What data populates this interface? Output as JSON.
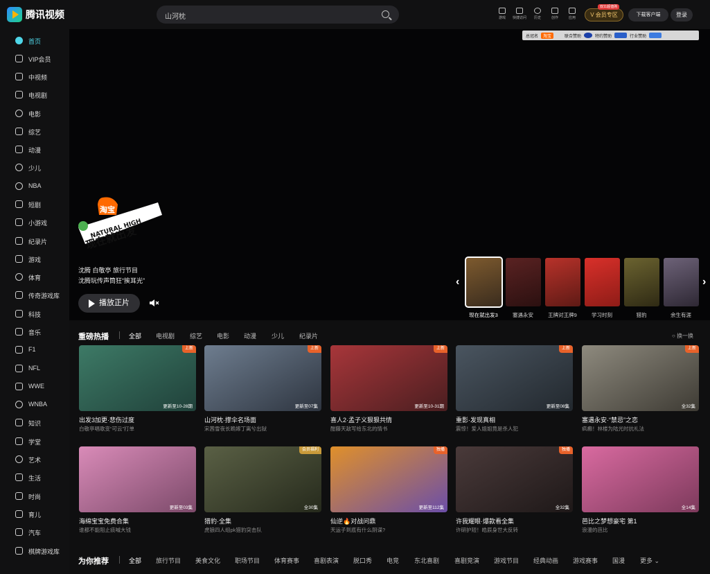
{
  "header": {
    "brand": "腾讯视频",
    "search_text": "山河枕",
    "tools": [
      "游戏",
      "快捷访问",
      "历史",
      "创作",
      "应用"
    ],
    "vip_tag": "双11超值购",
    "vip_label": "V 会员专区",
    "download_label": "下载客户端",
    "login_label": "登录"
  },
  "sidebar": {
    "items": [
      "首页",
      "VIP会员",
      "中视频",
      "电视剧",
      "电影",
      "综艺",
      "动漫",
      "少儿",
      "NBA",
      "短剧",
      "小游戏",
      "纪录片",
      "游戏",
      "体育",
      "传奇游戏库",
      "科技",
      "音乐",
      "F1",
      "NFL",
      "WWE",
      "WNBA",
      "知识",
      "学堂",
      "艺术",
      "生活",
      "时尚",
      "育儿",
      "汽车",
      "棋牌游戏库"
    ]
  },
  "hero": {
    "sponsors": [
      "总冠名",
      "淘宝",
      "联合赞助",
      "特约赞助",
      "行业赞助"
    ],
    "logo_text": [
      "淘宝",
      "NATURAL HIGH",
      "现在就出发"
    ],
    "line1": "沈腾 白敬亭 旅行节目",
    "line2": "沈腾玩传声筒狂“挨耳光”",
    "play_label": "播放正片",
    "thumbs": [
      "现在就出发3",
      "塞遇永安",
      "王牌对王牌9",
      "学习时刻",
      "猎豹",
      "余生有涯"
    ]
  },
  "section1": {
    "title": "重磅热播",
    "tabs": [
      "全部",
      "电视剧",
      "综艺",
      "电影",
      "动漫",
      "少儿",
      "纪录片"
    ],
    "refresh": "换一换",
    "cards": [
      {
        "title": "出发3加更·悲伤过度",
        "sub": "白敬亭唱歌变“可云”打单",
        "badge": "上新",
        "ep": "更新至10-28期",
        "color": "#3d7a66"
      },
      {
        "title": "山河枕·撑伞名场面",
        "sub": "宋茜雪夜长跪嫁丁离兮出狱",
        "badge": "上新",
        "ep": "更新至07集",
        "color": "#6e7d8f"
      },
      {
        "title": "喜人2·孟子义狠狠共情",
        "sub": "酣藤天敌写给东北的情书",
        "badge": "上新",
        "ep": "更新至10-31期",
        "color": "#a8363a"
      },
      {
        "title": "重影·发现真相",
        "sub": "震惊！爱人姐姐竟是杀人犯",
        "badge": "上新",
        "ep": "更新至08集",
        "color": "#4a5560"
      },
      {
        "title": "塞遇永安·“禁忌”之恋",
        "sub": "疯癫！林楼为陆光时抗礼法",
        "badge": "上新",
        "ep": "全32集",
        "color": "#8e8a7e"
      },
      {
        "title": "海绵宝宝免费合集",
        "sub": "谁都不能阻止痰喊大钱",
        "badge": "",
        "ep": "更新至03集",
        "color": "#d98bb8"
      },
      {
        "title": "猎豹·全集",
        "sub": "虎狼四人组pk猎豹突击队",
        "badge": "会员福利",
        "ep": "全30集",
        "color": "#5a6045"
      },
      {
        "title": "仙逆🔥对战问鼎",
        "sub": "天运子到底有什么阴谋?",
        "badge": "独播",
        "ep": "更新至112集",
        "color": "#6b4ea8"
      },
      {
        "title": "许我耀眼·爆款看全集",
        "sub": "许研护短！皓辰身世大反转",
        "badge": "独播",
        "ep": "全32集",
        "color": "#4a3a3a"
      },
      {
        "title": "芭比之梦想豪宅 第1",
        "sub": "浪漫的芭比",
        "badge": "",
        "ep": "全14集",
        "color": "#d96aa0"
      }
    ]
  },
  "section2": {
    "title": "为你推荐",
    "tabs": [
      "全部",
      "旅行节目",
      "美食文化",
      "职场节目",
      "体育赛事",
      "喜剧表演",
      "脱口秀",
      "电竞",
      "东北喜剧",
      "喜剧竞演",
      "游戏节目",
      "经典动画",
      "游戏赛事",
      "国漫",
      "更多"
    ]
  }
}
